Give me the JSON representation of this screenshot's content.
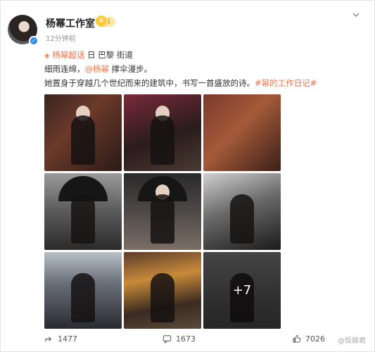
{
  "post": {
    "author": "杨幂工作室",
    "level_badge": "1",
    "time": "12分钟前",
    "topic_tag": "杨幂超话",
    "location": "日 巴黎 街道",
    "line2_prefix": "细雨连绵，",
    "mention": "@杨幂",
    "line2_suffix": " 撑伞漫步。",
    "line3_text": "她置身于穿越几个世纪而来的建筑中，书写一首盛放的诗。",
    "hashtag": "#幂的工作日记#",
    "more_images": "+7"
  },
  "actions": {
    "share_count": "1477",
    "comment_count": "1673",
    "like_count": "7026"
  },
  "watermark": "@饭娱君"
}
